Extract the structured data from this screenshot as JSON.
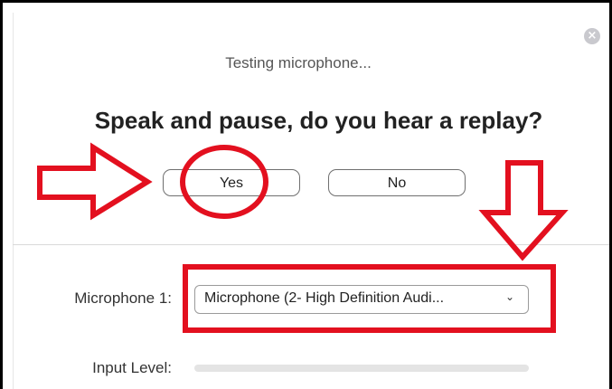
{
  "dialog": {
    "close_glyph": "×",
    "status": "Testing microphone...",
    "question": "Speak and pause, do you hear a replay?",
    "yes_label": "Yes",
    "no_label": "No"
  },
  "settings": {
    "microphone_label": "Microphone 1:",
    "microphone_value": "Microphone (2- High Definition Audi...",
    "chevron_glyph": "⌄",
    "input_level_label": "Input Level:",
    "input_level": 0
  },
  "colors": {
    "annotation": "#e3101f",
    "accent": "#2d8cff"
  }
}
